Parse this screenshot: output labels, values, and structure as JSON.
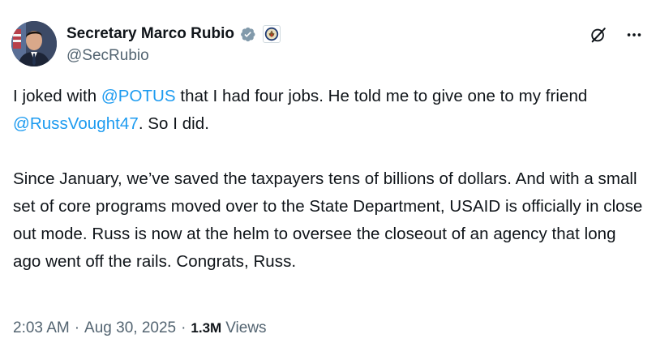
{
  "author": {
    "display_name": "Secretary Marco Rubio",
    "handle": "@SecRubio",
    "verified_badge_color": "#829aab",
    "affiliate_badge": "seal-icon"
  },
  "actions": {
    "grok_icon": "grok-icon",
    "more_icon": "more-icon"
  },
  "post": {
    "p1_a": "I joked with ",
    "p1_mention1": "@POTUS",
    "p1_b": " that I had four jobs. He told me to give one to my friend ",
    "p1_mention2": "@RussVought47",
    "p1_c": ". So I did.",
    "p2": "Since January, we’ve saved the taxpayers tens of billions of dollars. And with a small set of core programs moved over to the State Department, USAID is officially in close out mode. Russ is now at the helm to oversee the closeout of an agency that long ago went off the rails. Congrats, Russ."
  },
  "meta": {
    "time": "2:03 AM",
    "separator1": "·",
    "date": "Aug 30, 2025",
    "separator2": "·",
    "views_count": "1.3M",
    "views_label": "Views"
  },
  "colors": {
    "link": "#1d9bf0",
    "secondary_text": "#536471",
    "primary_text": "#0f1419"
  }
}
